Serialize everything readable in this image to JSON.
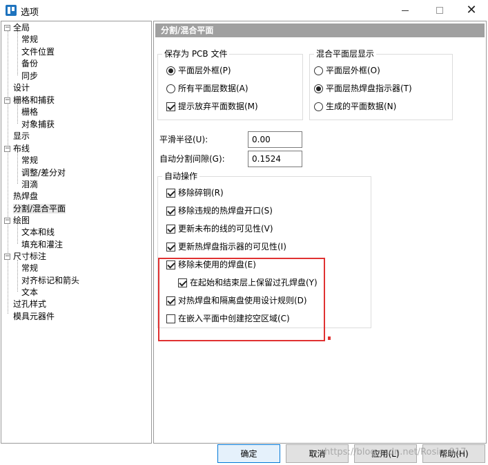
{
  "window": {
    "title": "选项",
    "icon": "pads-app-icon"
  },
  "tree": {
    "items": [
      {
        "label": "全局",
        "expander": "−"
      },
      {
        "label": "常规"
      },
      {
        "label": "文件位置"
      },
      {
        "label": "备份"
      },
      {
        "label": "同步"
      },
      {
        "label": "设计"
      },
      {
        "label": "栅格和捕获",
        "expander": "−"
      },
      {
        "label": "栅格"
      },
      {
        "label": "对象捕获"
      },
      {
        "label": "显示"
      },
      {
        "label": "布线",
        "expander": "−"
      },
      {
        "label": "常规"
      },
      {
        "label": "调整/差分对"
      },
      {
        "label": "泪滴"
      },
      {
        "label": "热焊盘"
      },
      {
        "label": "分割/混合平面",
        "selected": true
      },
      {
        "label": "绘图",
        "expander": "−"
      },
      {
        "label": "文本和线"
      },
      {
        "label": "填充和灌注"
      },
      {
        "label": "尺寸标注",
        "expander": "−"
      },
      {
        "label": "常规"
      },
      {
        "label": "对齐标记和箭头"
      },
      {
        "label": "文本"
      },
      {
        "label": "过孔样式"
      },
      {
        "label": "模具元器件"
      }
    ]
  },
  "panel": {
    "header": "分割/混合平面",
    "save_as_pcb": {
      "title": "保存为 PCB 文件",
      "options": [
        {
          "type": "radio",
          "label": "平面层外框(P)",
          "checked": true
        },
        {
          "type": "radio",
          "label": "所有平面层数据(A)",
          "checked": false
        },
        {
          "type": "check",
          "label": "提示放弃平面数据(M)",
          "checked": true
        }
      ]
    },
    "mixed_display": {
      "title": "混合平面层显示",
      "options": [
        {
          "type": "radio",
          "label": "平面层外框(O)",
          "checked": false
        },
        {
          "type": "radio",
          "label": "平面层热焊盘指示器(T)",
          "checked": true
        },
        {
          "type": "radio",
          "label": "生成的平面数据(N)",
          "checked": false
        }
      ]
    },
    "smooth_radius": {
      "label": "平滑半径(U):",
      "value": "0.00"
    },
    "auto_gap": {
      "label": "自动分割间隙(G):",
      "value": "0.1524"
    },
    "auto_ops": {
      "title": "自动操作",
      "options": [
        {
          "label": "移除碎铜(R)",
          "checked": true
        },
        {
          "label": "移除违规的热焊盘开口(S)",
          "checked": true
        },
        {
          "label": "更新未布的线的可见性(V)",
          "checked": true
        },
        {
          "label": "更新热焊盘指示器的可见性(I)",
          "checked": true
        },
        {
          "label": "移除未使用的焊盘(E)",
          "checked": true
        },
        {
          "label": "在起始和结束层上保留过孔焊盘(Y)",
          "checked": true
        },
        {
          "label": "对热焊盘和隔离盘使用设计规则(D)",
          "checked": true
        },
        {
          "label": "在嵌入平面中创建挖空区域(C)",
          "checked": false
        }
      ]
    }
  },
  "buttons": {
    "ok": "确定",
    "cancel": "取消",
    "apply": "应用(L)",
    "help": "帮助(H)"
  },
  "watermark": "https://blog.csdn.net/Rosin_917",
  "colors": {
    "highlight": "#e03131",
    "panel_header": "#a0a0a0",
    "default_button_border": "#0078d7"
  }
}
